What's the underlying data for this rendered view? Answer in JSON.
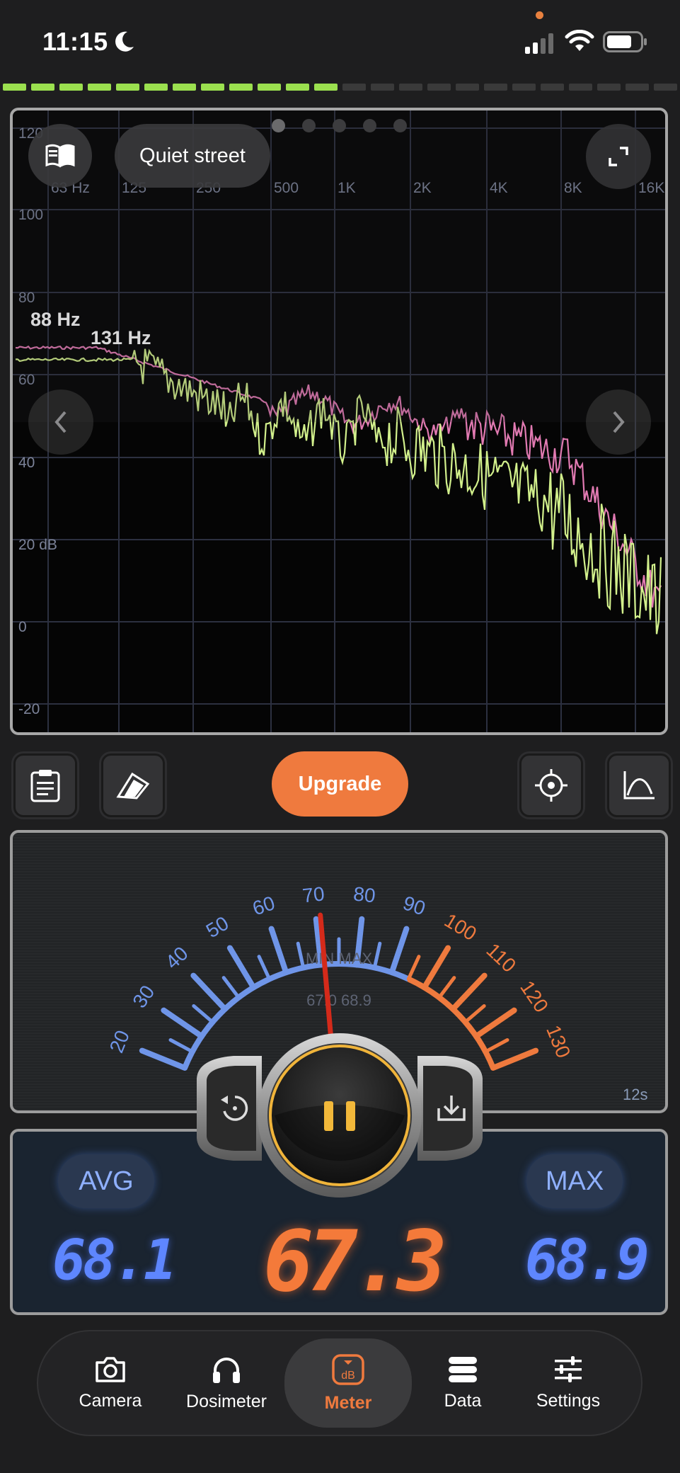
{
  "status_bar": {
    "time": "11:15"
  },
  "level_strip": {
    "segments_total": 24,
    "segments_lit": 12
  },
  "spectrum": {
    "preset_label": "Quiet street",
    "page_dots": 5,
    "active_page": 0,
    "x_ticks": [
      "63 Hz",
      "125",
      "250",
      "500",
      "1K",
      "2K",
      "4K",
      "8K",
      "16K"
    ],
    "y_ticks": [
      "120",
      "100",
      "80",
      "60",
      "40",
      "20 dB",
      "0",
      "-20"
    ],
    "peak_labels": [
      "88 Hz",
      "131 Hz"
    ],
    "colors": {
      "peak_hold": "#e17ab2",
      "live": "#d2f08c",
      "grid": "#2c3040"
    }
  },
  "toolbar": {
    "upgrade_label": "Upgrade"
  },
  "gauge": {
    "scale_labels": [
      "20",
      "30",
      "40",
      "50",
      "60",
      "70",
      "80",
      "90",
      "100",
      "110",
      "120",
      "130"
    ],
    "min_max_caption": "MIN MAX",
    "min_max_values": "67.0 68.9",
    "needle_value": 71,
    "elapsed": "12s",
    "colors": {
      "low": "#6f95e8",
      "high": "#ef7a3e",
      "needle": "#d42a1a"
    }
  },
  "readout": {
    "avg_label": "AVG",
    "max_label": "MAX",
    "avg_value": "68.1",
    "current_value": "67.3",
    "max_value": "68.9"
  },
  "tab_bar": {
    "tabs": [
      {
        "label": "Camera",
        "icon": "camera-icon"
      },
      {
        "label": "Dosimeter",
        "icon": "headphones-icon"
      },
      {
        "label": "Meter",
        "icon": "db-meter-icon"
      },
      {
        "label": "Data",
        "icon": "database-icon"
      },
      {
        "label": "Settings",
        "icon": "sliders-icon"
      }
    ],
    "active": "Meter"
  }
}
